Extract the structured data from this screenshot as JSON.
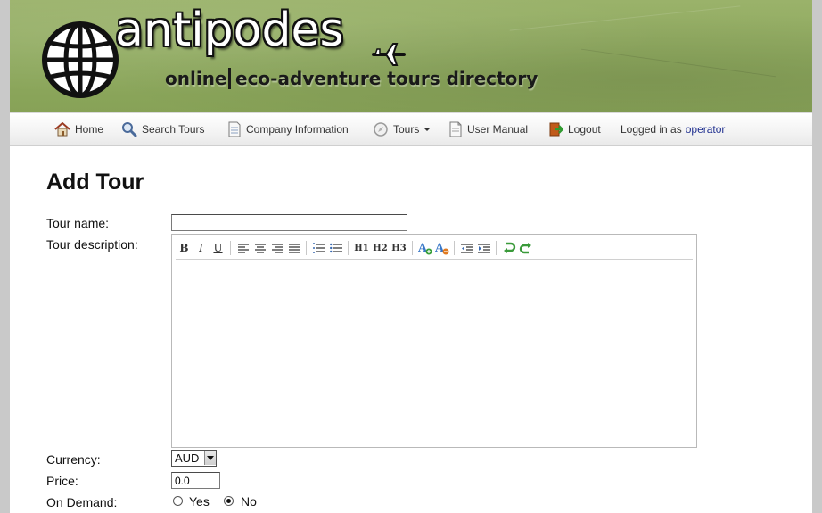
{
  "header": {
    "logo_word": "antipodes",
    "tagline_part1": "online",
    "tagline_part2": "eco-adventure tours directory"
  },
  "nav": {
    "home": "Home",
    "search_tours": "Search Tours",
    "company_information": "Company Information",
    "tours": "Tours",
    "user_manual": "User Manual",
    "logout": "Logout",
    "logged_in_prefix": "Logged in as",
    "username": "operator"
  },
  "page_title": "Add Tour",
  "form": {
    "tour_name_label": "Tour name:",
    "tour_name_value": "",
    "tour_description_label": "Tour description:",
    "editor_toolbar": {
      "bold": "B",
      "italic": "I",
      "underline": "U",
      "h1": "H1",
      "h2": "H2",
      "h3": "H3"
    },
    "currency_label": "Currency:",
    "currency_value": "AUD",
    "price_label": "Price:",
    "price_value": "0.0",
    "on_demand_label": "On Demand:",
    "on_demand_yes": "Yes",
    "on_demand_no": "No",
    "on_demand_selected": "No"
  },
  "colors": {
    "banner_green": "#8ea95e",
    "link_blue": "#1f2f8f"
  }
}
